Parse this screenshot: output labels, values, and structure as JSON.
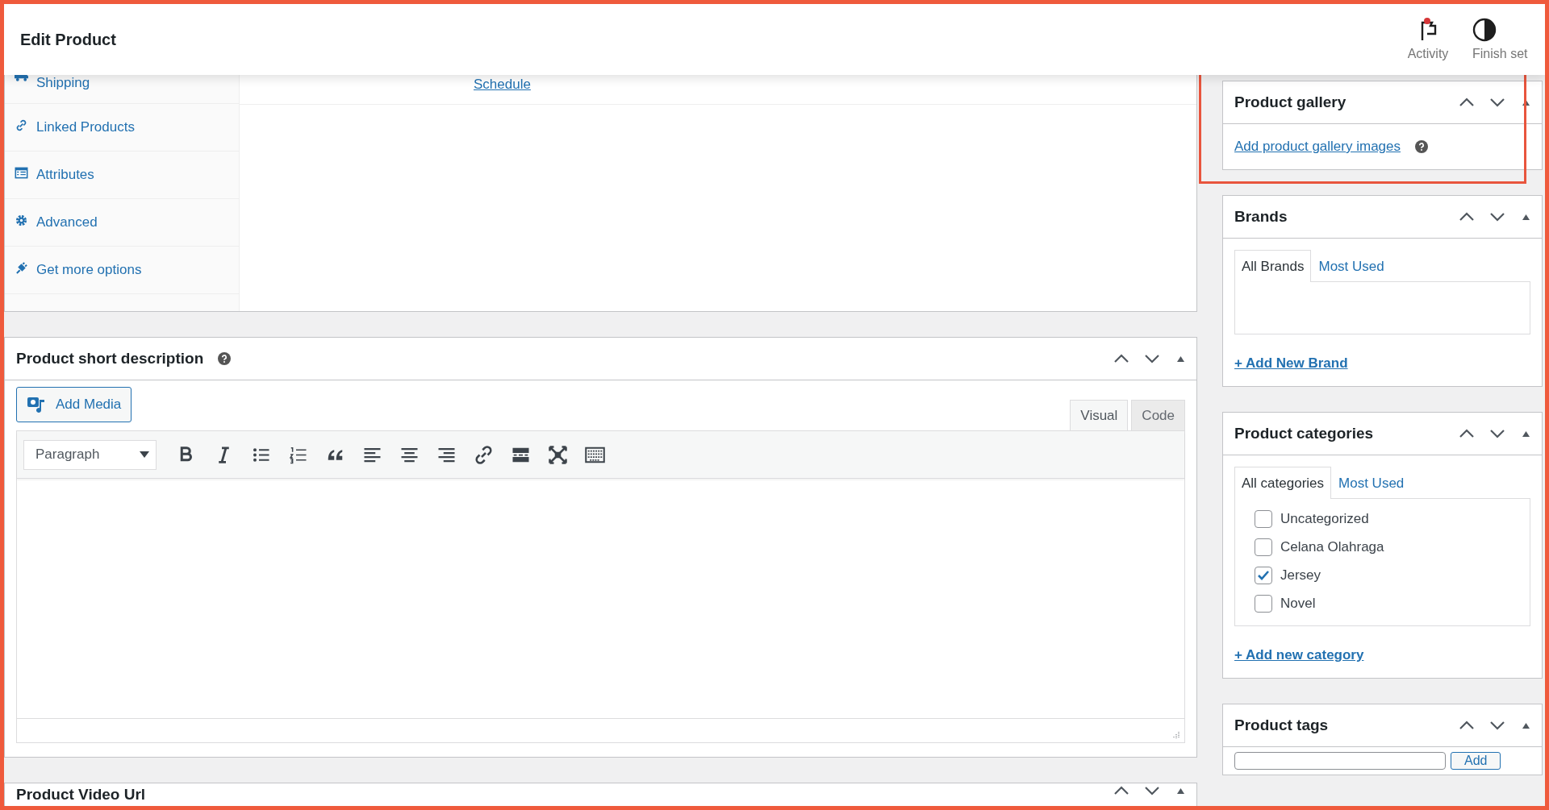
{
  "header": {
    "title": "Edit Product",
    "actions": [
      {
        "kind": "activity",
        "label": "Activity",
        "notification": true
      },
      {
        "kind": "setup",
        "label": "Finish set"
      }
    ]
  },
  "product_data": {
    "tabs": [
      {
        "kind": "shipping",
        "label": "Shipping"
      },
      {
        "kind": "linked",
        "label": "Linked Products"
      },
      {
        "kind": "attributes",
        "label": "Attributes"
      },
      {
        "kind": "advanced",
        "label": "Advanced"
      },
      {
        "kind": "more",
        "label": "Get more options"
      }
    ],
    "schedule_link": "Schedule"
  },
  "short_description": {
    "title": "Product short description",
    "add_media": "Add Media",
    "format_select": "Paragraph",
    "editor_tabs": [
      {
        "label": "Visual",
        "selected": true
      },
      {
        "label": "Code",
        "selected": false
      }
    ]
  },
  "video_url": {
    "title": "Product Video Url"
  },
  "sidebar": [
    {
      "kind": "gallery",
      "title": "Product gallery",
      "link": "Add product gallery images",
      "highlighted": true
    },
    {
      "kind": "taxonomy",
      "title": "Brands",
      "tabs": [
        {
          "label": "All Brands",
          "selected": true
        },
        {
          "label": "Most Used",
          "selected": false
        }
      ],
      "add_link": "+ Add New Brand"
    },
    {
      "kind": "taxonomy",
      "title": "Product categories",
      "tabs": [
        {
          "label": "All categories",
          "selected": true
        },
        {
          "label": "Most Used",
          "selected": false
        }
      ],
      "items": [
        {
          "label": "Uncategorized",
          "checked": false
        },
        {
          "label": "Celana Olahraga",
          "checked": false
        },
        {
          "label": "Jersey",
          "checked": true
        },
        {
          "label": "Novel",
          "checked": false
        }
      ],
      "add_link": "+ Add new category"
    },
    {
      "kind": "tags",
      "title": "Product tags",
      "button": "Add"
    }
  ]
}
